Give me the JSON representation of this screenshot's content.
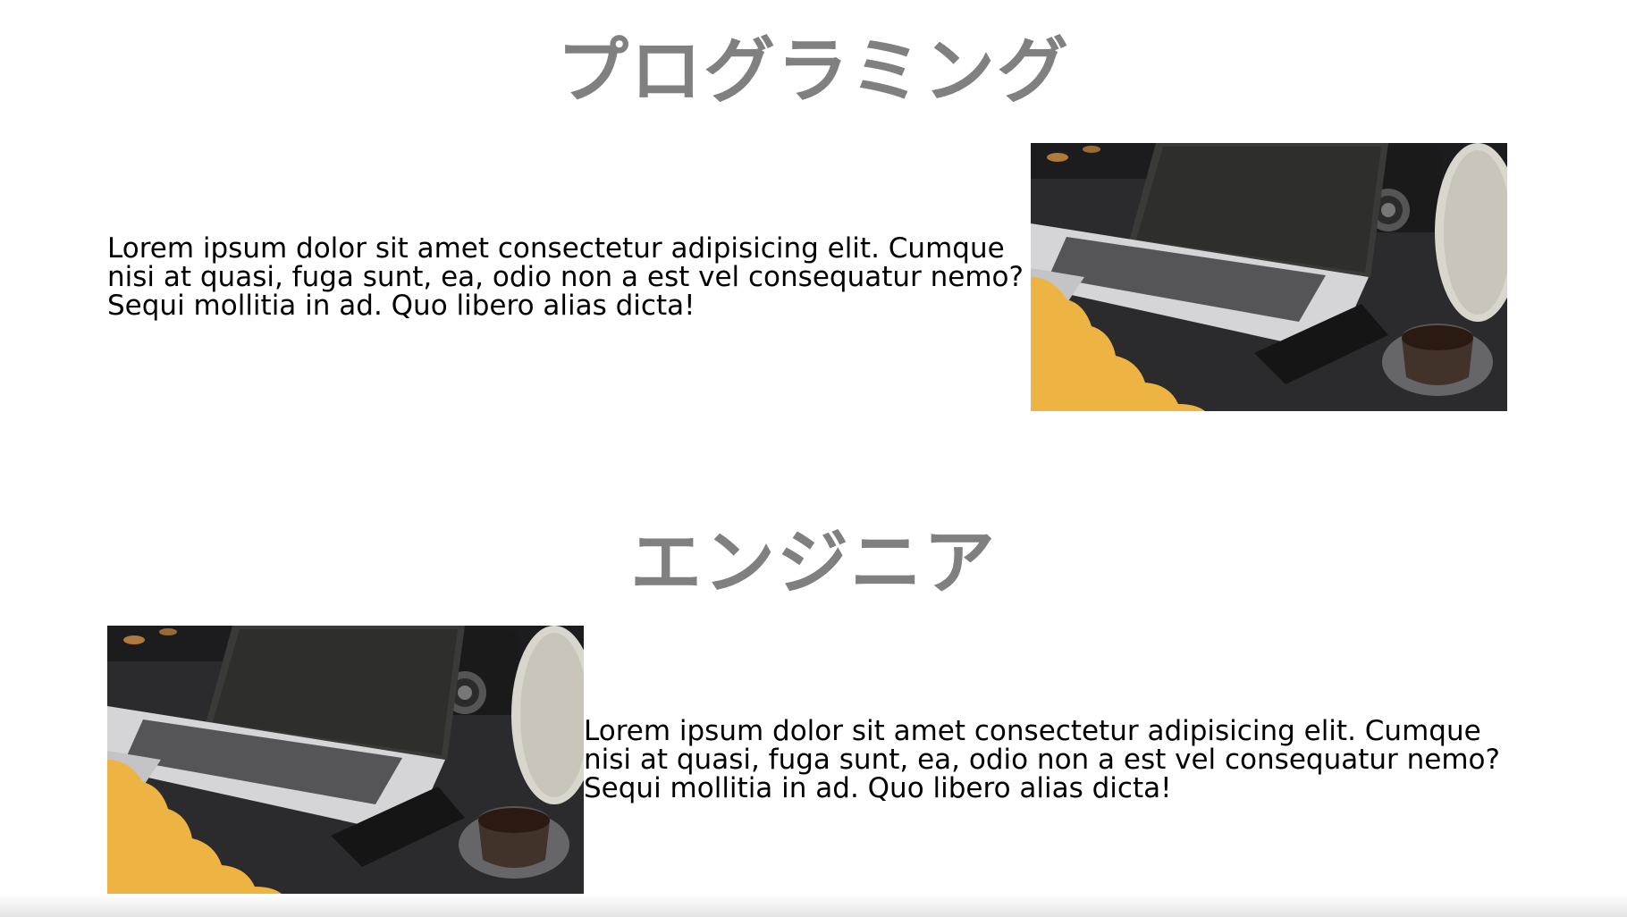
{
  "sections": [
    {
      "heading": "プログラミング",
      "text": "Lorem ipsum dolor sit amet consectetur adipisicing elit. Cumque nisi at quasi, fuga sunt, ea, odio non a est vel consequatur nemo? Sequi mollitia in ad. Quo libero alias dicta!",
      "image_alt": "laptop-coffee-photo"
    },
    {
      "heading": "エンジニア",
      "text": "Lorem ipsum dolor sit amet consectetur adipisicing elit. Cumque nisi at quasi, fuga sunt, ea, odio non a est vel consequatur nemo? Sequi mollitia in ad. Quo libero alias dicta!",
      "image_alt": "laptop-coffee-photo"
    }
  ],
  "colors": {
    "heading": "#808080",
    "text": "#000000",
    "accent_blob": "#EDB443",
    "desk": "#2a2a2c"
  }
}
